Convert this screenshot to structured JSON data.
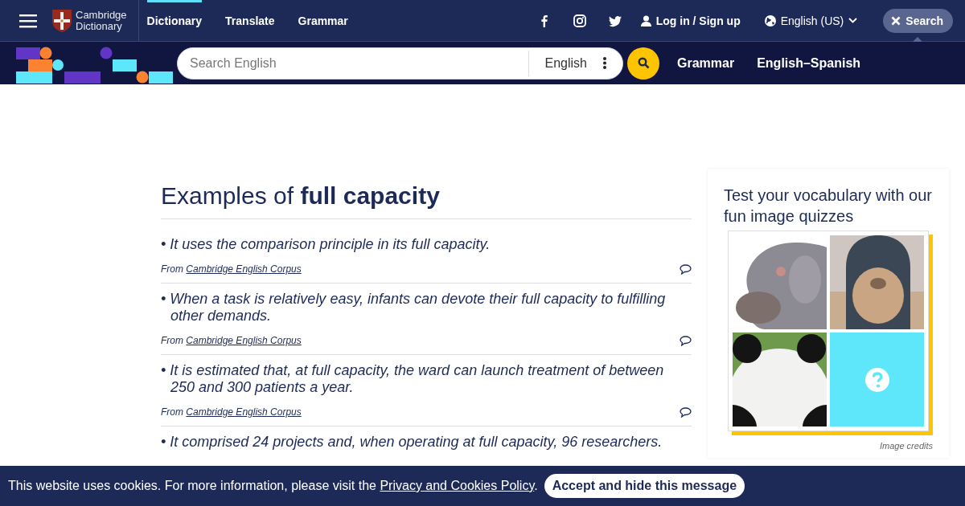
{
  "header": {
    "logo": {
      "line1": "Cambridge",
      "line2": "Dictionary"
    },
    "nav": [
      {
        "label": "Dictionary",
        "selected": true
      },
      {
        "label": "Translate",
        "selected": false
      },
      {
        "label": "Grammar",
        "selected": false
      }
    ],
    "login": "Log in / Sign up",
    "language": "English (US)",
    "search_toggle": "Search"
  },
  "search_bar": {
    "placeholder": "Search English",
    "dictionary": "English",
    "links": [
      "Grammar",
      "English–Spanish"
    ]
  },
  "heading": "Examples of **full capacity**",
  "examples": [
    {
      "text": "• It uses the comparison principle in its full capacity.",
      "source_prefix": "From",
      "source": "Cambridge English Corpus"
    },
    {
      "text": "• When a task is relatively easy, infants can devote their full capacity to fulfilling other demands.",
      "source_prefix": "From",
      "source": "Cambridge English Corpus"
    },
    {
      "text": "• It is estimated that, at full capacity, the ward can launch treatment of between 250 and 300 patients a year.",
      "source_prefix": "From",
      "source": "Cambridge English Corpus"
    },
    {
      "text": "• It comprised 24 projects and, when operating at full capacity, 96 researchers."
    }
  ],
  "quiz": {
    "title": "Test your vocabulary with our fun image quizzes",
    "tiles": [
      {
        "kind": "picture"
      },
      {
        "kind": "picture"
      },
      {
        "kind": "picture"
      },
      {
        "kind": "question"
      }
    ],
    "credits": "Image credits"
  },
  "cookie": {
    "message": "This website uses cookies. For more information, please visit the",
    "link": "Privacy and Cookies Policy",
    "end": ".",
    "button": "Accept and hide this message"
  }
}
